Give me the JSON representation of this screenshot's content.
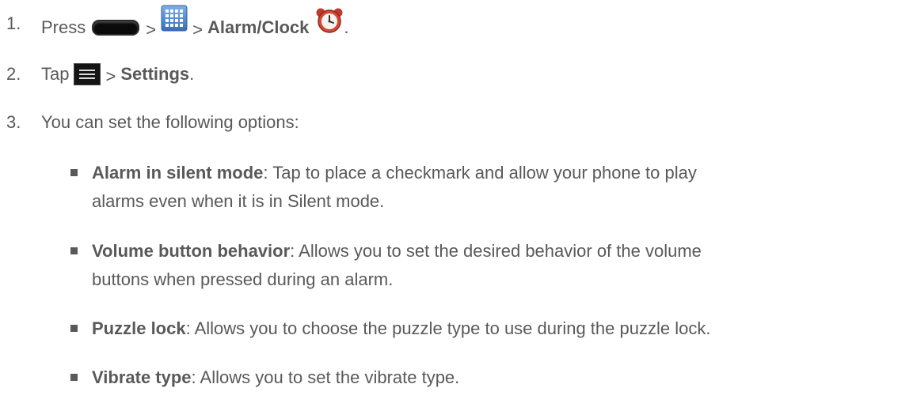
{
  "steps": [
    {
      "number": "1.",
      "prefix": "Press",
      "sep1": ">",
      "sep2": ">",
      "bold": "Alarm/Clock",
      "suffix": ".",
      "icons": [
        "home-key-icon",
        "apps-grid-icon",
        "alarm-clock-icon"
      ]
    },
    {
      "number": "2.",
      "prefix": "Tap",
      "sep1": ">",
      "bold": "Settings",
      "suffix": ".",
      "icons": [
        "menu-key-icon"
      ]
    },
    {
      "number": "3.",
      "text": "You can set the following options:"
    }
  ],
  "options": [
    {
      "term": "Alarm in silent mode",
      "line1": ": Tap to place a checkmark and allow your phone to play",
      "line2": "alarms even when it is in Silent mode."
    },
    {
      "term": "Volume button behavior",
      "line1": ": Allows you to set the desired behavior of the volume",
      "line2": "buttons when pressed during an alarm."
    },
    {
      "term": "Puzzle lock",
      "line1": ": Allows you to choose the puzzle type to use during the puzzle lock.",
      "line2": ""
    },
    {
      "term": "Vibrate type",
      "line1": ": Allows you to set the vibrate type.",
      "line2": ""
    }
  ],
  "colors": {
    "text": "#595959",
    "clock_red": "#c0392b",
    "apps_blue": "#4a7fc1"
  }
}
